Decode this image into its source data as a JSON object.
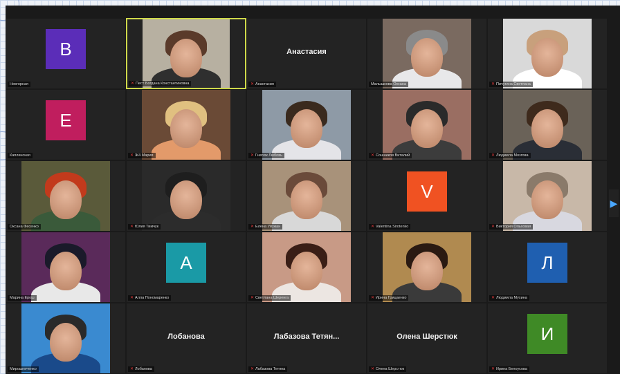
{
  "meeting": {
    "next_page_glyph": "▶",
    "tiles": [
      {
        "type": "avatar",
        "letter": "В",
        "color": "#5b2db8",
        "label": "Невгорная",
        "mic": false
      },
      {
        "type": "video",
        "label": "Пест Богдана Константиновна",
        "mic": true,
        "bg": "#b7b0a1",
        "hair": "#5a3a2a",
        "shirt": "#2f2f2f",
        "active": true
      },
      {
        "type": "name",
        "name": "Анастасия",
        "label": "Анастасия",
        "mic": true
      },
      {
        "type": "video",
        "label": "Малышкова Оксана",
        "mic": false,
        "bg": "#7a6a60",
        "hair": "#8a8a8a",
        "shirt": "#e8e8ea"
      },
      {
        "type": "video",
        "label": "Пичугина Светлана",
        "mic": true,
        "bg": "#d9d9d9",
        "hair": "#c8a07c",
        "shirt": "#ffffff"
      },
      {
        "type": "avatar",
        "letter": "Е",
        "color": "#c01e5e",
        "label": "Каплинская",
        "mic": false
      },
      {
        "type": "video",
        "label": "Ж4 Мария",
        "mic": true,
        "bg": "#6a4a36",
        "hair": "#e0c080",
        "shirt": "#e39a6a"
      },
      {
        "type": "video",
        "label": "Гнатюк Любовь",
        "mic": true,
        "bg": "#8e9aa6",
        "hair": "#3a2a1e",
        "shirt": "#e4e4e8"
      },
      {
        "type": "video",
        "label": "Сошников Виталий",
        "mic": true,
        "bg": "#9a6e62",
        "hair": "#2a2a2a",
        "shirt": "#3c3c3c"
      },
      {
        "type": "video",
        "label": "Людмила Мозгова",
        "mic": true,
        "bg": "#6a6258",
        "hair": "#3e2a1c",
        "shirt": "#2a2e36"
      },
      {
        "type": "video",
        "label": "Оксана Фесенко",
        "mic": false,
        "bg": "#5a5a3a",
        "hair": "#c23a1c",
        "shirt": "#3a5a3a"
      },
      {
        "type": "video",
        "label": "Юлия Тимчук",
        "mic": true,
        "bg": "#2a2a2a",
        "hair": "#1e1e1e",
        "shirt": "#2c2c2c"
      },
      {
        "type": "video",
        "label": "Елена Уйзжан",
        "mic": true,
        "bg": "#a8927a",
        "hair": "#6a4a3a",
        "shirt": "#d8d8d8"
      },
      {
        "type": "avatar",
        "letter": "V",
        "color": "#f05222",
        "label": "Valentina Sirotenko",
        "mic": true
      },
      {
        "type": "video",
        "label": "Виктория Ольховая",
        "mic": true,
        "bg": "#c8b8a8",
        "hair": "#8a7a6a",
        "shirt": "#d8d8e0"
      },
      {
        "type": "video",
        "label": "Марина Ерош",
        "mic": false,
        "bg": "#5a2a5a",
        "hair": "#1a1a2a",
        "shirt": "#e8e8e8"
      },
      {
        "type": "avatar",
        "letter": "A",
        "color": "#1a9aa6",
        "label": "Алла Пономаренко",
        "mic": true
      },
      {
        "type": "video",
        "label": "Светлана Шеренга",
        "mic": true,
        "bg": "#c89a86",
        "hair": "#3a1e16",
        "shirt": "#ece6e2"
      },
      {
        "type": "video",
        "label": "Ирина Грицаенко",
        "mic": true,
        "bg": "#b08a50",
        "hair": "#2a1a12",
        "shirt": "#3a3a3a"
      },
      {
        "type": "avatar",
        "letter": "Л",
        "color": "#1f5fb0",
        "label": "Людмила Мухина",
        "mic": true
      },
      {
        "type": "video",
        "label": "Мирошниченко",
        "mic": false,
        "bg": "#3a8ad0",
        "hair": "#2a2a2a",
        "shirt": "#1a4a8a"
      },
      {
        "type": "name",
        "name": "Лобанова",
        "label": "Лобанова",
        "mic": true
      },
      {
        "type": "name",
        "name": "Лабазова Тетян...",
        "label": "Лабазова Тетяна",
        "mic": true
      },
      {
        "type": "name",
        "name": "Олена Шерстюк",
        "label": "Олена Шерстюк",
        "mic": true
      },
      {
        "type": "avatar",
        "letter": "И",
        "color": "#3f8a26",
        "label": "Ирина Белоусова",
        "mic": true
      }
    ]
  }
}
